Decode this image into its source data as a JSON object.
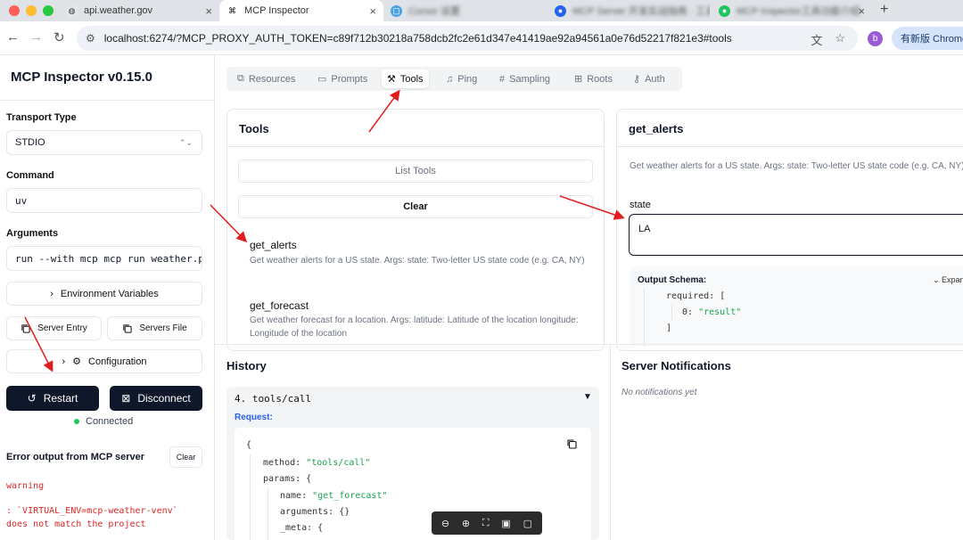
{
  "browser": {
    "tabs": [
      {
        "label": "api.weather.gov"
      },
      {
        "label": "MCP Inspector"
      },
      {
        "label": "Cursor 设置"
      },
      {
        "label": "MCP Server 开发实战指南 · 工具"
      },
      {
        "label": "MCP Inspector工具功能介绍"
      }
    ],
    "url": "localhost:6274/?MCP_PROXY_AUTH_TOKEN=c89f712b30218a758dcb2fc2e61d347e41419ae92a94561a0e76d52217f821e3#tools",
    "profile_initial": "b",
    "update_label": "有新版 Chrome"
  },
  "sidebar": {
    "title": "MCP Inspector v0.15.0",
    "transport_label": "Transport Type",
    "transport_value": "STDIO",
    "command_label": "Command",
    "command_value": "uv",
    "arguments_label": "Arguments",
    "arguments_value": "run --with mcp mcp run weather.py",
    "env_vars_label": "Environment Variables",
    "server_entry_label": "Server Entry",
    "servers_file_label": "Servers File",
    "configuration_label": "Configuration",
    "restart_label": "Restart",
    "disconnect_label": "Disconnect",
    "status_label": "Connected",
    "error_title": "Error output from MCP server",
    "error_clear_label": "Clear",
    "error_lines": [
      "warning",
      ": `VIRTUAL_ENV=mcp-weather-venv`",
      "does not match the project"
    ]
  },
  "main_tabs": [
    {
      "label": "Resources"
    },
    {
      "label": "Prompts"
    },
    {
      "label": "Tools"
    },
    {
      "label": "Ping"
    },
    {
      "label": "Sampling"
    },
    {
      "label": "Roots"
    },
    {
      "label": "Auth"
    }
  ],
  "tools_panel": {
    "title": "Tools",
    "list_label": "List Tools",
    "clear_label": "Clear",
    "items": [
      {
        "name": "get_alerts",
        "desc": "Get weather alerts for a US state. Args: state: Two-letter US state code (e.g. CA, NY)"
      },
      {
        "name": "get_forecast",
        "desc": "Get weather forecast for a location. Args: latitude: Latitude of the location longitude: Longitude of the location"
      }
    ]
  },
  "detail_panel": {
    "title": "get_alerts",
    "desc": "Get weather alerts for a US state. Args: state: Two-letter US state code (e.g. CA, NY)",
    "state_label": "state",
    "state_value": "LA",
    "schema_title": "Output Schema:",
    "schema_expand": "Expand",
    "schema_required": "required: [",
    "schema_index": "0:",
    "schema_value": "\"result\"",
    "schema_close": "]"
  },
  "history": {
    "title": "History",
    "item_head": "4. tools/call",
    "request_label": "Request:",
    "code": {
      "open": "{",
      "method_key": "method:",
      "method_val": "\"tools/call\"",
      "params_key": "params: {",
      "name_key": "name:",
      "name_val": "\"get_forecast\"",
      "arguments": "arguments: {}",
      "meta": "_meta: {"
    }
  },
  "notifications": {
    "title": "Server Notifications",
    "empty": "No notifications yet"
  }
}
